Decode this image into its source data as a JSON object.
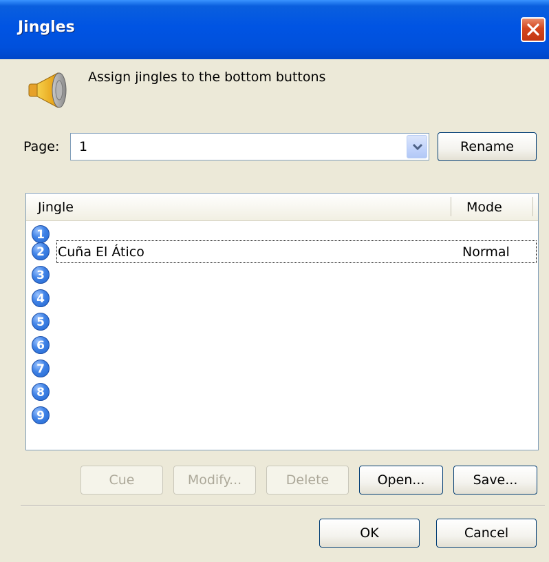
{
  "window": {
    "title": "Jingles"
  },
  "header": {
    "text": "Assign jingles to the bottom buttons"
  },
  "page": {
    "label": "Page:",
    "value": "1",
    "rename_label": "Rename"
  },
  "list": {
    "columns": {
      "jingle": "Jingle",
      "mode": "Mode"
    },
    "rows": [
      {
        "num": "1",
        "name": "",
        "mode": ""
      },
      {
        "num": "2",
        "name": "Cuña El Ático",
        "mode": "Normal"
      },
      {
        "num": "3",
        "name": "",
        "mode": ""
      },
      {
        "num": "4",
        "name": "",
        "mode": ""
      },
      {
        "num": "5",
        "name": "",
        "mode": ""
      },
      {
        "num": "6",
        "name": "",
        "mode": ""
      },
      {
        "num": "7",
        "name": "",
        "mode": ""
      },
      {
        "num": "8",
        "name": "",
        "mode": ""
      },
      {
        "num": "9",
        "name": "",
        "mode": ""
      }
    ]
  },
  "actions": {
    "cue": "Cue",
    "modify": "Modify...",
    "delete": "Delete",
    "open": "Open...",
    "save": "Save..."
  },
  "footer": {
    "ok": "OK",
    "cancel": "Cancel"
  },
  "colors": {
    "title_bar": "#0054e3",
    "dialog_bg": "#ece9d8",
    "number_icon": "#2b6fd6"
  }
}
